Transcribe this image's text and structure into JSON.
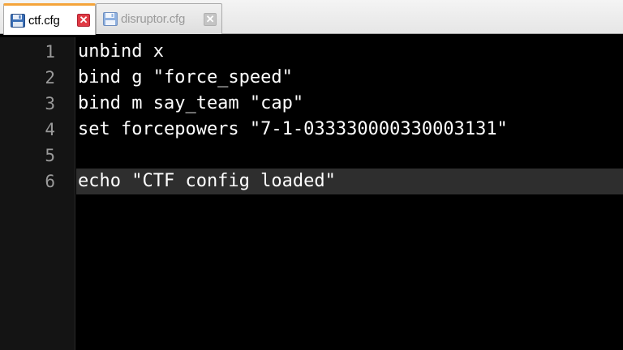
{
  "tabs": [
    {
      "label": "ctf.cfg",
      "icon": "save-icon",
      "close": "✕",
      "active": true
    },
    {
      "label": "disruptor.cfg",
      "icon": "save-icon",
      "close": "✕",
      "active": false
    }
  ],
  "editor": {
    "current_line": 6,
    "lines": [
      {
        "num": "1",
        "text": "unbind x"
      },
      {
        "num": "2",
        "text": "bind g \"force_speed\""
      },
      {
        "num": "3",
        "text": "bind m say_team \"cap\""
      },
      {
        "num": "4",
        "text": "set forcepowers \"7-1-033330000330003131\""
      },
      {
        "num": "5",
        "text": ""
      },
      {
        "num": "6",
        "text": "echo \"CTF config loaded\""
      }
    ]
  },
  "colors": {
    "active_tab_accent": "#f4a43a",
    "close_active": "#e03a44",
    "editor_bg": "#000000",
    "current_line_bg": "#2e2e2e"
  }
}
